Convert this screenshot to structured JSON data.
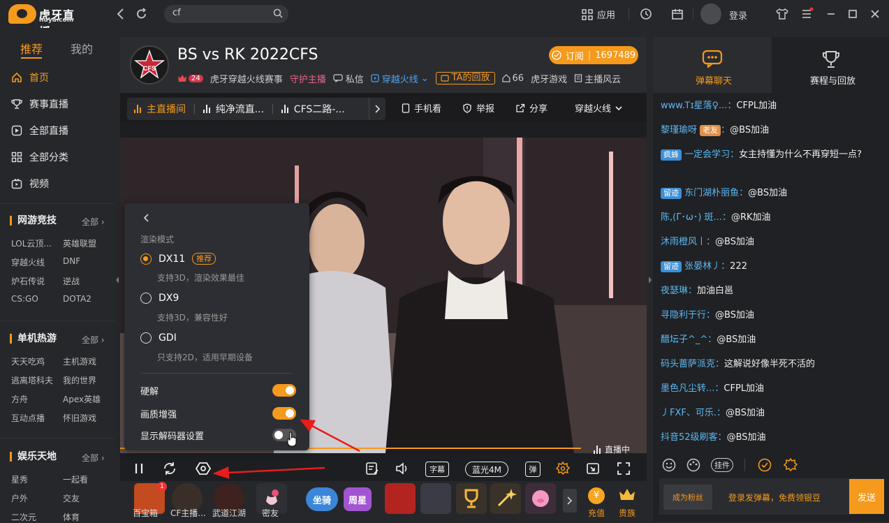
{
  "app": {
    "logo_text": "虎牙直播",
    "logo_sub": "huya.com",
    "search_value": "cf",
    "apps_label": "应用",
    "login_label": "登录"
  },
  "sidebar": {
    "tabs": [
      "推荐",
      "我的"
    ],
    "nav": [
      {
        "label": "首页",
        "icon": "home-icon"
      },
      {
        "label": "赛事直播",
        "icon": "trophy-icon"
      },
      {
        "label": "全部直播",
        "icon": "play-icon"
      },
      {
        "label": "全部分类",
        "icon": "grid-icon"
      },
      {
        "label": "视频",
        "icon": "video-icon"
      }
    ],
    "sections": [
      {
        "title": "网游竞技",
        "all": "全部",
        "items": [
          "LOL云顶...",
          "英雄联盟",
          "穿越火线",
          "DNF",
          "炉石传说",
          "逆战",
          "CS:GO",
          "DOTA2"
        ]
      },
      {
        "title": "单机热游",
        "all": "全部",
        "items": [
          "天天吃鸡",
          "主机游戏",
          "逃离塔科夫",
          "我的世界",
          "方舟",
          "Apex英雄",
          "互动点播",
          "怀旧游戏"
        ]
      },
      {
        "title": "娱乐天地",
        "all": "全部",
        "items": [
          "星秀",
          "一起看",
          "户外",
          "交友",
          "二次元",
          "体育"
        ]
      }
    ]
  },
  "room": {
    "title": "BS vs RK 2022CFS",
    "level": "24",
    "host": "虎牙穿越火线赛事",
    "guard": "守护主播",
    "message": "私信",
    "category": "穿越火线",
    "replay": "TA的回放",
    "room_id": "66",
    "publisher": "虎牙游戏",
    "style": "主播风云",
    "subscribe_label": "订阅",
    "subscribers": "1697489"
  },
  "lines": {
    "items": [
      "主直播间",
      "纯净流直...",
      "CFS二路-..."
    ],
    "actions": [
      "手机看",
      "举报",
      "分享"
    ],
    "game_select": "穿越火线"
  },
  "video": {
    "live_label": "直播中",
    "subtitle_btn": "字幕",
    "quality": "蓝光4M",
    "danmu_btn": "弹"
  },
  "popup": {
    "section_title": "渲染模式",
    "modes": [
      {
        "name": "DX11",
        "tag": "推荐",
        "desc": "支持3D，渲染效果最佳",
        "selected": true
      },
      {
        "name": "DX9",
        "tag": "",
        "desc": "支持3D，兼容性好",
        "selected": false
      },
      {
        "name": "GDI",
        "tag": "",
        "desc": "只支持2D，适用早期设备",
        "selected": false
      }
    ],
    "toggles": [
      {
        "label": "硬解",
        "on": true
      },
      {
        "label": "画质增强",
        "on": true
      },
      {
        "label": "显示解码器设置",
        "on": false
      }
    ]
  },
  "gifts": [
    {
      "label": "百宝箱",
      "badge": "1"
    },
    {
      "label": "CF主播..."
    },
    {
      "label": "武道江湖"
    },
    {
      "label": "密友"
    },
    {
      "label": "坐骑"
    },
    {
      "label": "周星"
    },
    {
      "label": "充值"
    },
    {
      "label": "贵族"
    }
  ],
  "chat": {
    "tabs": [
      "弹幕聊天",
      "赛程与回放"
    ],
    "messages": [
      {
        "user": "www.Ꭲɪ星落♀...",
        "badge": "",
        "text": "CFPL加油"
      },
      {
        "user": "黎瑾瑜呀",
        "badge": "老友",
        "text": "@BS加油"
      },
      {
        "user": "一定会学习",
        "badge": "疯蜂",
        "text": "女主持懂为什么不再穿短一点?"
      },
      {
        "user": "东门湖朴丽鱼",
        "badge": "留迹",
        "text": "@BS加油"
      },
      {
        "user": "陈,(Γ･ω･) 斑...",
        "badge": "",
        "text": "@RK加油"
      },
      {
        "user": "沐雨橙风丨",
        "badge": "",
        "text": "@BS加油"
      },
      {
        "user": "张晏林丿",
        "badge": "留迹",
        "text": "222"
      },
      {
        "user": "夜瑟琳",
        "badge": "",
        "text": "加油白邕"
      },
      {
        "user": "寻隐利于行",
        "badge": "",
        "text": "@BS加油"
      },
      {
        "user": "醋坛子^_^",
        "badge": "",
        "text": "@BS加油"
      },
      {
        "user": "码头蔷萨派克",
        "badge": "",
        "text": "这解说好像半死不活的"
      },
      {
        "user": "墨色凡尘转...",
        "badge": "",
        "text": "CFPL加油"
      },
      {
        "user": "丿FXF、可乐.",
        "badge": "",
        "text": "@BS加油"
      },
      {
        "user": "抖音52级刷客",
        "badge": "",
        "text": "@BS加油"
      }
    ],
    "tools_label": "挂件",
    "fan_btn": "成为粉丝",
    "input_placeholder": "登录发弹幕，免费领银豆",
    "send_label": "发送"
  },
  "colors": {
    "accent": "#f59a1c",
    "username": "#5cb8f2",
    "arrow": "#e81c1c"
  }
}
